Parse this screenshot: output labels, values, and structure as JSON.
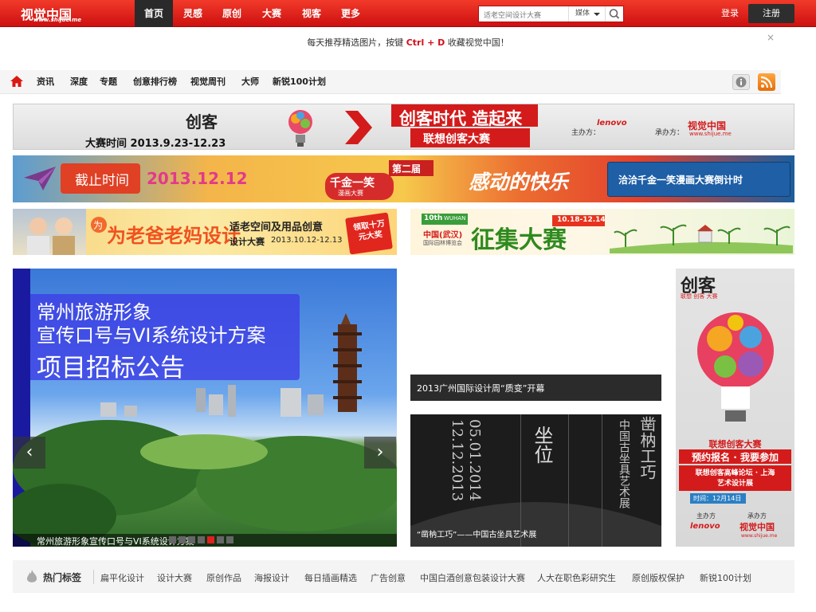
{
  "topbar": {
    "logo_text": "视觉中国",
    "logo_sub": "www.shijue.me",
    "nav": [
      "首页",
      "灵感",
      "原创",
      "大赛",
      "视客",
      "更多"
    ],
    "search_placeholder": "适老空间设计大赛",
    "search_scope": "媒体",
    "login": "登录",
    "register": "注册"
  },
  "tip": {
    "prefix": "每天推荐精选图片，按键",
    "hotkey": "Ctrl + D",
    "suffix": "收藏视觉中国！",
    "close": "×"
  },
  "subnav": {
    "items": [
      "资讯",
      "深度",
      "专题",
      "创意排行榜",
      "视觉周刊",
      "大师",
      "新锐100计划"
    ]
  },
  "banners": {
    "b1": {
      "brand": "创客",
      "date": "大赛时间 2013.9.23-12.23",
      "headline": "创客时代 造起来",
      "sub": "联想创客大赛",
      "host_label": "主办方：",
      "host": "lenovo",
      "co_label": "承办方：",
      "co": "视觉中国",
      "co_sub": "www.shijue.me"
    },
    "b2": {
      "deadline_label": "截止时间",
      "deadline": "2013.12.12",
      "badge": "千金一笑",
      "badge_sub": "漫画大赛",
      "edition": "第二届",
      "slogan": "感动的快乐",
      "cta": "洽洽千金一笑漫画大赛倒计时"
    },
    "b3": {
      "title": "为老爸老妈设计",
      "subject": "适老空间及用品创意",
      "line2": "设计大赛",
      "dates": "2013.10.12-12.13",
      "prize": "领取十万元大奖"
    },
    "b4": {
      "edition": "10th",
      "city": "WUHAN",
      "expo": "中国(武汉)",
      "expo_sub": "国际园林博览会",
      "title": "征集大赛",
      "dates": "10.18-12.14"
    }
  },
  "slider": {
    "title1": "常州旅游形象",
    "title2": "宣传口号与VI系统设计方案",
    "title3": "项目招标公告",
    "caption": "常州旅游形象宣传口号与VI系统设计方案",
    "prev": "‹",
    "next": "›",
    "active_dot": 5
  },
  "mid": {
    "item1": "2013广州国际设计周“质变”开幕",
    "item2": "“凿枘工巧”——中国古坐具艺术展",
    "poster_title": "凿枘工巧",
    "poster_sub": "中国古坐具艺术展",
    "poster_word": "坐位",
    "poster_date1": "12.12.2013",
    "poster_date2": "05.01.2014"
  },
  "right_ad": {
    "brand": "创客",
    "brand_sub": "联想 创客 大赛",
    "l1": "联想创客大赛",
    "l2": "预约报名 · 我要参加",
    "l3": "联想创客高峰论坛 · 上海",
    "l4": "艺术设计展",
    "l5": "时间：12月14日",
    "host_label": "主办方",
    "co_label": "承办方",
    "host": "lenovo",
    "co": "视觉中国",
    "co_sub": "www.shijue.me"
  },
  "hottags": {
    "label": "热门标签",
    "tags": [
      "扁平化设计",
      "设计大赛",
      "原创作品",
      "海报设计",
      "每日插画精选",
      "广告创意",
      "中国白酒创意包装设计大赛",
      "人大在职色彩研究生",
      "原创版权保护",
      "新锐100计划"
    ]
  },
  "colors": {
    "brand_red": "#d91a12",
    "accent_red": "#d0101a",
    "dark": "#2e2e2e"
  }
}
